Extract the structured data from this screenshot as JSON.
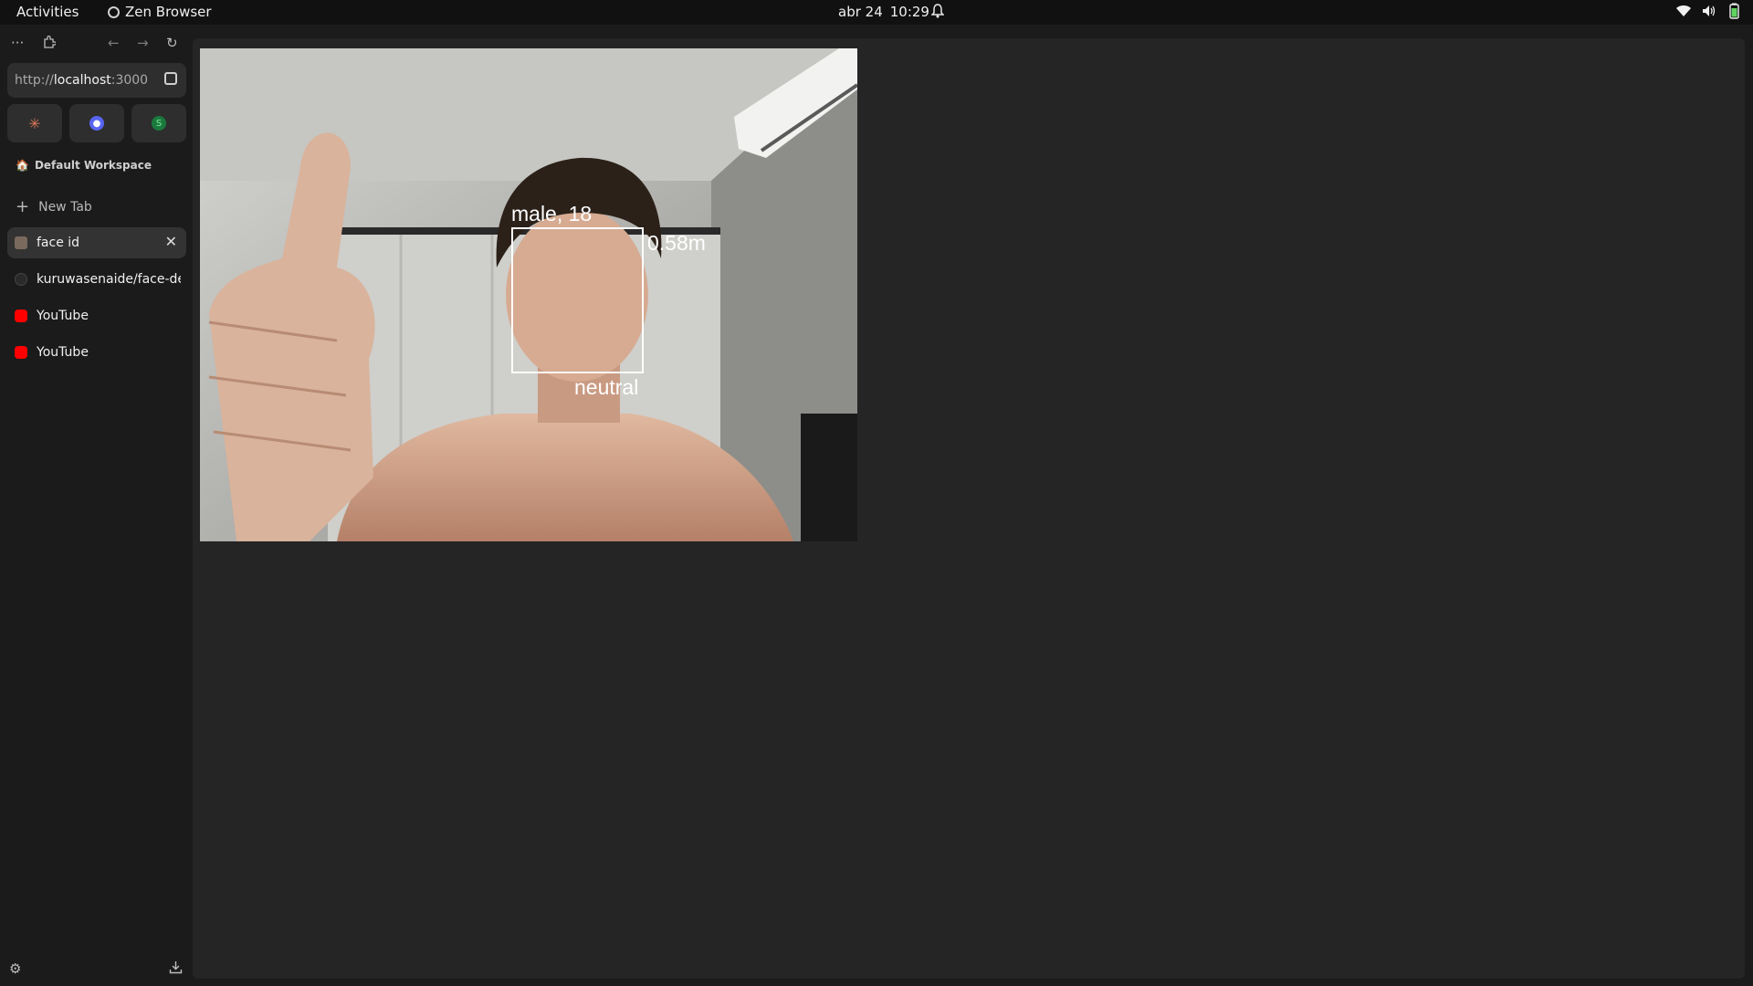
{
  "topbar": {
    "activities": "Activities",
    "app_name": "Zen Browser",
    "date": "abr 24",
    "time": "10:29",
    "icons": [
      "bell-icon",
      "wifi-icon",
      "volume-icon",
      "battery-icon"
    ]
  },
  "sidebar": {
    "nav_icons": [
      "more-icon",
      "extensions-icon",
      "back-arrow-icon",
      "forward-arrow-icon",
      "reload-icon"
    ],
    "url": {
      "scheme": "http://",
      "host": "localhost",
      "port": ":3000"
    },
    "essentials": [
      {
        "name": "claude",
        "color": "#d97757"
      },
      {
        "name": "discord",
        "color": "#5865f2"
      },
      {
        "name": "spotify",
        "color": "#1db954"
      }
    ],
    "workspace": "Default Workspace",
    "new_tab": "New Tab",
    "tabs": [
      {
        "label": "face id",
        "active": true
      },
      {
        "label": "kuruwasenaide/face-de",
        "active": false
      },
      {
        "label": "YouTube",
        "active": false
      },
      {
        "label": "YouTube",
        "active": false
      }
    ]
  },
  "detection": {
    "gender_age": "male, 18",
    "distance": "0.58m",
    "emotion": "neutral"
  },
  "colors": {
    "accent_youtube": "#ff0000",
    "content_bg": "#252525",
    "sidebar_bg": "#1b1b1b"
  }
}
